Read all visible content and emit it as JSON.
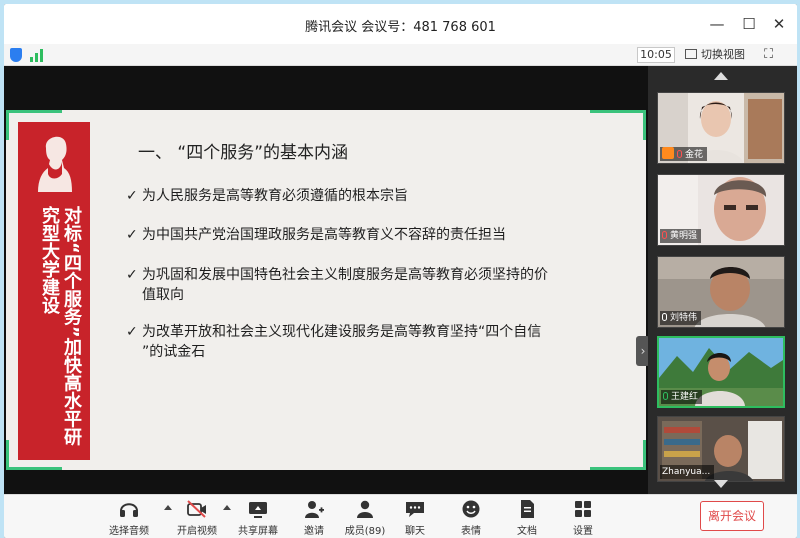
{
  "window": {
    "title": "腾讯会议 会议号：481 768 601",
    "controls": {
      "minimize": "—",
      "maximize": "☐",
      "close": "✕"
    }
  },
  "toolbar": {
    "time": "10:05",
    "switch_view_label": "切换视图",
    "fullscreen_glyph": "⛶"
  },
  "slide": {
    "title": "一、 “四个服务”的基本内涵",
    "banner_text": "对标“四个服务”加快高水平研究型大学建设",
    "bullets": [
      {
        "check": "✓",
        "text": "为人民服务是高等教育必须遵循的根本宗旨"
      },
      {
        "check": "✓",
        "text": "为中国共产党治国理政服务是高等教育义不容辞的责任担当"
      },
      {
        "check": "✓",
        "text": "为巩固和发展中国特色社会主义制度服务是高等教育必须坚持的价\n值取向"
      },
      {
        "check": "✓",
        "text": "为改革开放和社会主义现代化建设服务是高等教育坚持“四个自信\n”的试金石"
      }
    ],
    "collapse_glyph": "›"
  },
  "participants": [
    {
      "name": "金花",
      "muted": true,
      "host": true
    },
    {
      "name": "黄明强",
      "muted": true,
      "host": false
    },
    {
      "name": "刘特伟",
      "muted": false,
      "host": false
    },
    {
      "name": "王建红",
      "muted": false,
      "host": false,
      "speaking": true
    },
    {
      "name": "Zhanyua...",
      "muted": false,
      "host": false
    }
  ],
  "controls": {
    "audio": "选择音频",
    "video": "开启视频",
    "share": "共享屏幕",
    "invite": "邀请",
    "members": "成员(89)",
    "chat": "聊天",
    "reactions": "表情",
    "docs": "文档",
    "settings": "设置",
    "leave": "离开会议"
  },
  "colors": {
    "banner_red": "#c8232a",
    "accent_green": "#2ebd5f",
    "leave_red": "#e04a4a"
  }
}
